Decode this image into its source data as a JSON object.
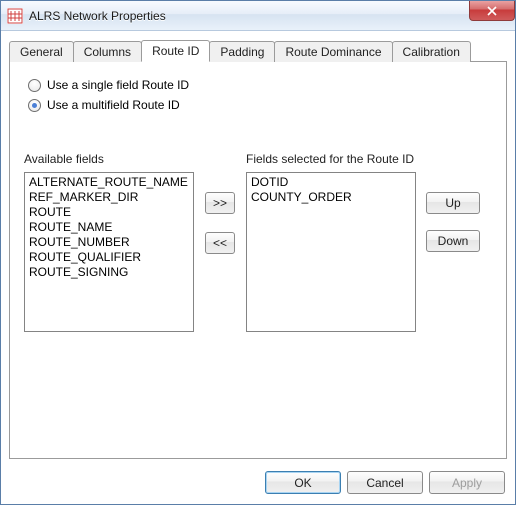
{
  "window": {
    "title": "ALRS Network Properties"
  },
  "tabs": {
    "t0": "General",
    "t1": "Columns",
    "t2": "Route ID",
    "t3": "Padding",
    "t4": "Route Dominance",
    "t5": "Calibration",
    "active": 2
  },
  "radios": {
    "single": "Use a single field Route ID",
    "multi": "Use a multifield Route ID",
    "selected": "multi"
  },
  "labels": {
    "available": "Available fields",
    "selected": "Fields selected for the Route ID",
    "move_right": ">>",
    "move_left": "<<",
    "up": "Up",
    "down": "Down"
  },
  "available_fields": [
    "ALTERNATE_ROUTE_NAME",
    "REF_MARKER_DIR",
    "ROUTE",
    "ROUTE_NAME",
    "ROUTE_NUMBER",
    "ROUTE_QUALIFIER",
    "ROUTE_SIGNING"
  ],
  "selected_fields": [
    "DOTID",
    "COUNTY_ORDER"
  ],
  "footer": {
    "ok": "OK",
    "cancel": "Cancel",
    "apply": "Apply"
  }
}
